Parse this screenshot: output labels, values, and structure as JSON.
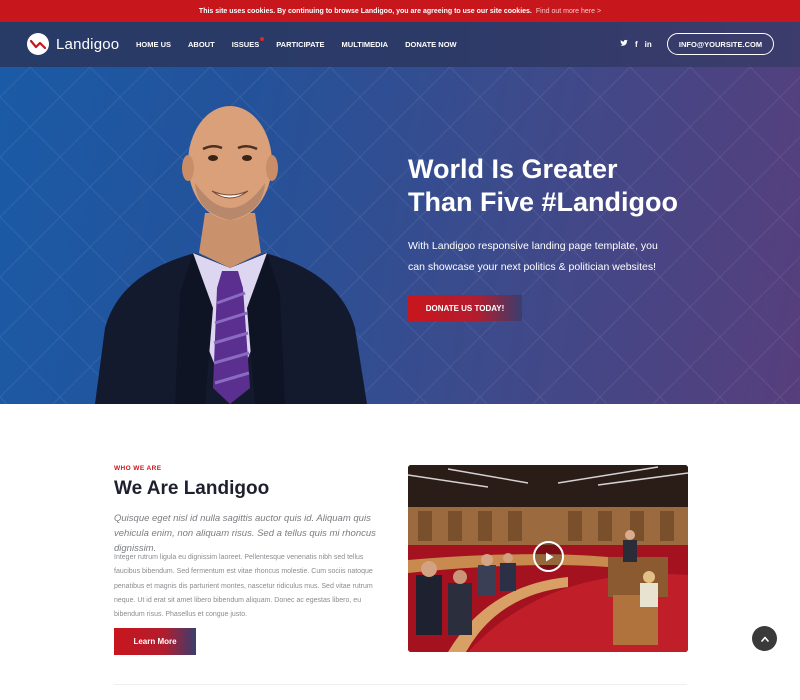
{
  "cookie_bar": {
    "message": "This site uses cookies. By continuing to browse Landigoo, you are agreeing to use our site cookies.",
    "link": "Find out more here >"
  },
  "brand": {
    "name": "Landigoo"
  },
  "nav": {
    "items": [
      {
        "label": "HOME US"
      },
      {
        "label": "ABOUT"
      },
      {
        "label": "ISSUES"
      },
      {
        "label": "PARTICIPATE"
      },
      {
        "label": "MULTIMEDIA"
      },
      {
        "label": "DONATE NOW"
      }
    ],
    "social": {
      "twitter": "t",
      "facebook": "f",
      "linkedin": "in"
    },
    "email_button": "INFO@YOURSITE.COM"
  },
  "hero": {
    "title_line1": "World Is Greater",
    "title_line2": "Than Five #Landigoo",
    "subtitle": "With Landigoo responsive landing page template, you can showcase your next politics & politician websites!",
    "cta": "DONATE US TODAY!"
  },
  "about": {
    "eyebrow": "WHO WE ARE",
    "title": "We Are Landigoo",
    "lead": "Quisque eget nisl id nulla sagittis auctor quis id. Aliquam quis vehicula enim, non aliquam risus. Sed a tellus quis mi rhoncus dignissim.",
    "body": "Integer rutrum ligula eu dignissim laoreet. Pellentesque venenatis nibh sed tellus faucibus bibendum. Sed fermentum est vitae rhoncus molestie. Cum sociis natoque penatibus et magnis dis parturient montes, nascetur ridiculus mus. Sed vitae rutrum neque. Ut id erat sit amet libero bibendum aliquam. Donec ac egestas libero, eu bibendum risus. Phasellus et congue justo.",
    "button": "Learn More"
  },
  "colors": {
    "accent_red": "#c8161d",
    "nav_navy": "#2c3a68",
    "hero_blue": "#1b5aa6",
    "hero_purple": "#573e7c"
  }
}
